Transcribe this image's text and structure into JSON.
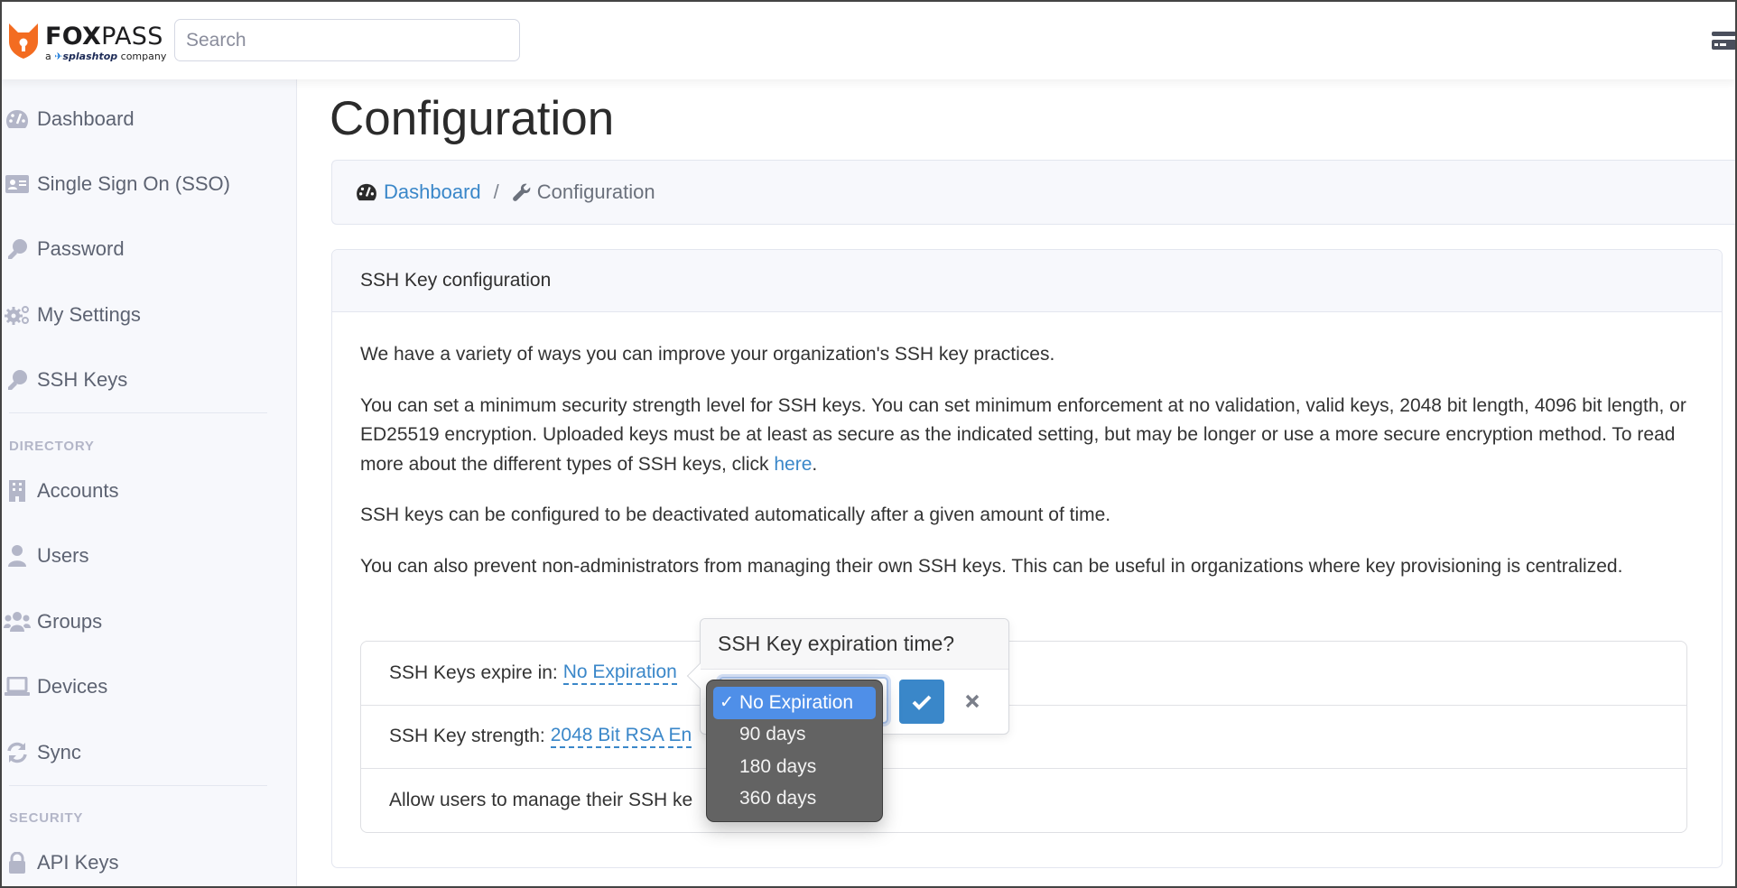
{
  "header": {
    "logo_brand_bold": "FOX",
    "logo_brand_light": "PASS",
    "logo_tagline_prefix": "a",
    "logo_tagline_brand": "splashtop",
    "logo_tagline_suffix": "company",
    "search_placeholder": "Search",
    "search_value": "",
    "menu_icon": "hamburger-card-icon"
  },
  "sidebar": {
    "items": [
      {
        "label": "Dashboard",
        "icon": "tachometer-icon"
      },
      {
        "label": "Single Sign On (SSO)",
        "icon": "id-card-icon"
      },
      {
        "label": "Password",
        "icon": "key-icon"
      },
      {
        "label": "My Settings",
        "icon": "cogs-icon"
      },
      {
        "label": "SSH Keys",
        "icon": "key-icon"
      }
    ],
    "sections": [
      {
        "title": "DIRECTORY",
        "items": [
          {
            "label": "Accounts",
            "icon": "building-icon"
          },
          {
            "label": "Users",
            "icon": "user-icon"
          },
          {
            "label": "Groups",
            "icon": "users-icon"
          },
          {
            "label": "Devices",
            "icon": "laptop-icon"
          },
          {
            "label": "Sync",
            "icon": "sync-icon"
          }
        ]
      },
      {
        "title": "SECURITY",
        "items": [
          {
            "label": "API Keys",
            "icon": "lock-icon"
          }
        ]
      }
    ]
  },
  "page": {
    "title": "Configuration",
    "breadcrumb": {
      "home_label": "Dashboard",
      "separator": "/",
      "current_label": "Configuration"
    }
  },
  "card": {
    "title": "SSH Key configuration",
    "paragraphs": {
      "p1": "We have a variety of ways you can improve your organization's SSH key practices.",
      "p2_text": "You can set a minimum security strength level for SSH keys. You can set minimum enforcement at no validation, valid keys, 2048 bit length, 4096 bit length, or ED25519 encryption. Uploaded keys must be at least as secure as the indicated setting, but may be longer or use a more secure encryption method. To read more about the different types of SSH keys, click ",
      "p2_link": "here",
      "p2_end": ".",
      "p3": "SSH keys can be configured to be deactivated automatically after a given amount of time.",
      "p4": "You can also prevent non-administrators from managing their own SSH keys. This can be useful in organizations where key provisioning is centralized."
    },
    "settings": [
      {
        "label": "SSH Keys expire in:",
        "value": "No Expiration"
      },
      {
        "label": "SSH Key strength:",
        "value": "2048 Bit RSA En"
      },
      {
        "label": "Allow users to manage their SSH ke",
        "value": ""
      }
    ]
  },
  "popover": {
    "title": "SSH Key expiration time?",
    "ok_icon": "check-icon",
    "cancel_icon": "close-icon",
    "select": {
      "selected": "No Expiration",
      "check_mark": "✓",
      "options": [
        "No Expiration",
        "90 days",
        "180 days",
        "360 days"
      ]
    }
  },
  "colors": {
    "link": "#3a87c9",
    "primary_button": "#3a87c9",
    "sidebar_bg": "#f7f8fc",
    "dropdown_bg": "#636363",
    "dropdown_selected": "#4f8fe8",
    "logo_orange": "#f36c21"
  }
}
